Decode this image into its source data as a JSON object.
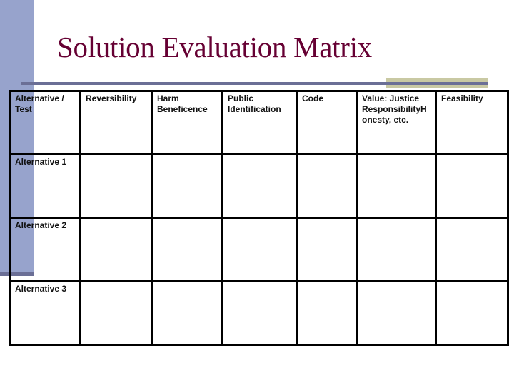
{
  "slide": {
    "title": "Solution Evaluation Matrix",
    "colors": {
      "title": "#660033",
      "left_bar": "#97a3cc",
      "rule": "#6b6f96",
      "accent_block": "#c9c9a3"
    }
  },
  "table": {
    "headers": [
      "Alternative / Test",
      "Reversibility",
      "Harm Beneficence",
      "Public Identification",
      "Code",
      "Value: Justice ResponsibilityH onesty, etc.",
      "Feasibility"
    ],
    "header_lines": {
      "value_line1": "Value: Justice",
      "value_line2": "ResponsibilityH",
      "value_line3": "onesty, etc."
    },
    "rows": [
      {
        "label": "Alternative 1",
        "cells": [
          "",
          "",
          "",
          "",
          "",
          ""
        ]
      },
      {
        "label": "Alternative 2",
        "cells": [
          "",
          "",
          "",
          "",
          "",
          ""
        ]
      },
      {
        "label": "Alternative 3",
        "cells": [
          "",
          "",
          "",
          "",
          "",
          ""
        ]
      }
    ]
  }
}
